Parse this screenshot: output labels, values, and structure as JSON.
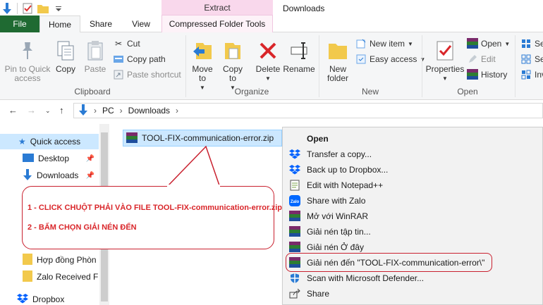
{
  "window": {
    "title": "Downloads",
    "context_tab_group": "Extract"
  },
  "tabs": {
    "file": "File",
    "home": "Home",
    "share": "Share",
    "view": "View",
    "compressed": "Compressed Folder Tools"
  },
  "ribbon": {
    "clipboard": {
      "pin": "Pin to Quick access",
      "copy": "Copy",
      "paste": "Paste",
      "cut": "Cut",
      "copy_path": "Copy path",
      "paste_shortcut": "Paste shortcut",
      "label": "Clipboard"
    },
    "organize": {
      "move_to": "Move to",
      "copy_to": "Copy to",
      "delete": "Delete",
      "rename": "Rename",
      "label": "Organize"
    },
    "new": {
      "new_folder": "New folder",
      "new_item": "New item",
      "easy_access": "Easy access",
      "label": "New"
    },
    "open": {
      "properties": "Properties",
      "open": "Open",
      "edit": "Edit",
      "history": "History",
      "label": "Open"
    },
    "select": {
      "se1": "Se",
      "se2": "Se",
      "inv": "Inv"
    }
  },
  "address": {
    "pc": "PC",
    "downloads": "Downloads",
    "sep": "›"
  },
  "nav": {
    "quick_access": "Quick access",
    "desktop": "Desktop",
    "downloads": "Downloads",
    "hop_dong": "Hợp đồng Phòn",
    "zalo": "Zalo Received Fi",
    "dropbox": "Dropbox"
  },
  "file": {
    "name": "TOOL-FIX-communication-error.zip"
  },
  "annotation": {
    "line1": "1 - CLICK CHUỘT PHẢI VÀO FILE  TOOL-FIX-communication-error.zip",
    "line2": "2 - BẤM CHỌN GIẢI NÉN ĐẾN"
  },
  "context_menu": [
    {
      "label": "Open",
      "icon": "none"
    },
    {
      "label": "Transfer a copy...",
      "icon": "dropbox-icon"
    },
    {
      "label": "Back up to Dropbox...",
      "icon": "dropbox-icon"
    },
    {
      "label": "Edit with Notepad++",
      "icon": "notepad-icon"
    },
    {
      "label": "Share with Zalo",
      "icon": "zalo-icon"
    },
    {
      "label": "Mở với WinRAR",
      "icon": "winrar-icon"
    },
    {
      "label": "Giải nén tập tin...",
      "icon": "winrar-icon"
    },
    {
      "label": "Giải nén Ở đây",
      "icon": "winrar-icon"
    },
    {
      "label": "Giải nén đến \"TOOL-FIX-communication-error\\\"",
      "icon": "winrar-icon"
    },
    {
      "label": "Scan with Microsoft Defender...",
      "icon": "defender-icon"
    },
    {
      "label": "Share",
      "icon": "share-icon"
    }
  ],
  "colors": {
    "file_tab": "#1f6a32",
    "extract_tab": "#f9d8ec",
    "selection": "#cce8ff",
    "annotation_red": "#d9262a",
    "dropbox_blue": "#0061fe"
  }
}
